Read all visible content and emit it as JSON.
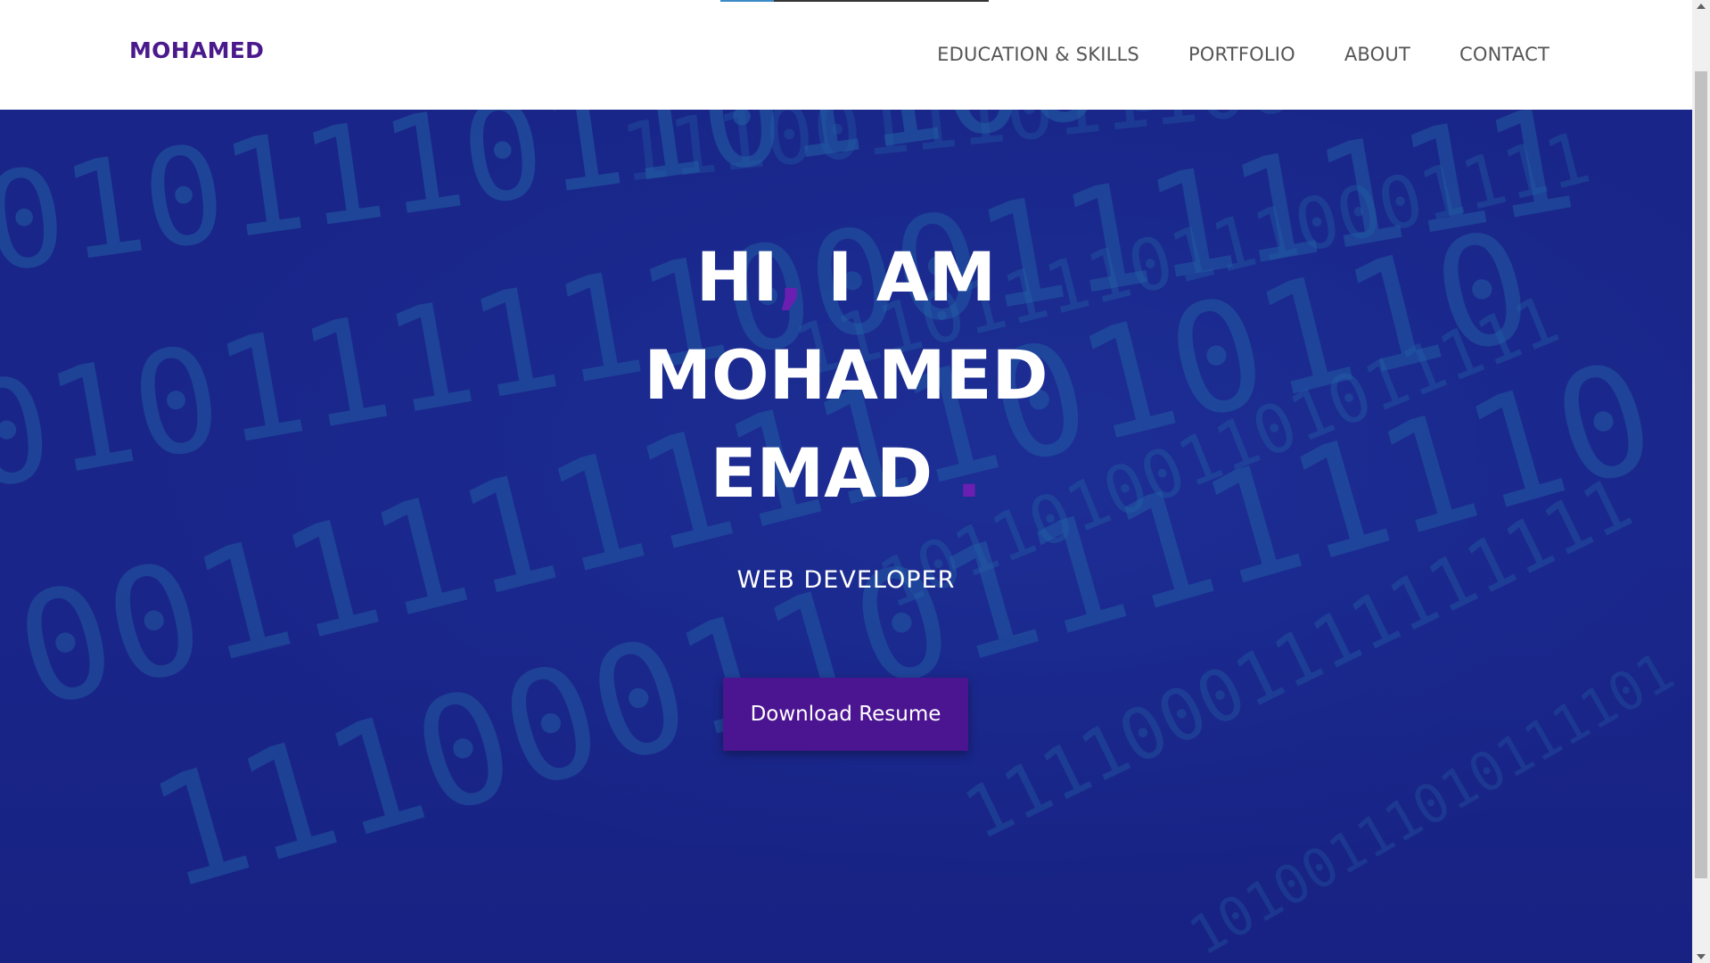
{
  "navbar": {
    "brand": "MOHAMED",
    "links": [
      "EDUCATION & SKILLS",
      "PORTFOLIO",
      "ABOUT",
      "CONTACT"
    ]
  },
  "hero": {
    "line1_pre": "HI",
    "line1_comma": ",",
    "line1_post": " I AM",
    "line2": "MOHAMED",
    "line3": "EMAD",
    "line3_dot": ".",
    "subtitle": "WEB DEVELOPER",
    "cta_label": "Download Resume"
  },
  "colors": {
    "brand": "#4a1a8c",
    "accent": "#6a1fb0",
    "cta_bg": "#4b1591",
    "hero_bg": "#1c2b90",
    "binary_digits": "#2fa6c9"
  },
  "icons": [
    "scroll-up-arrow",
    "scroll-down-arrow"
  ]
}
